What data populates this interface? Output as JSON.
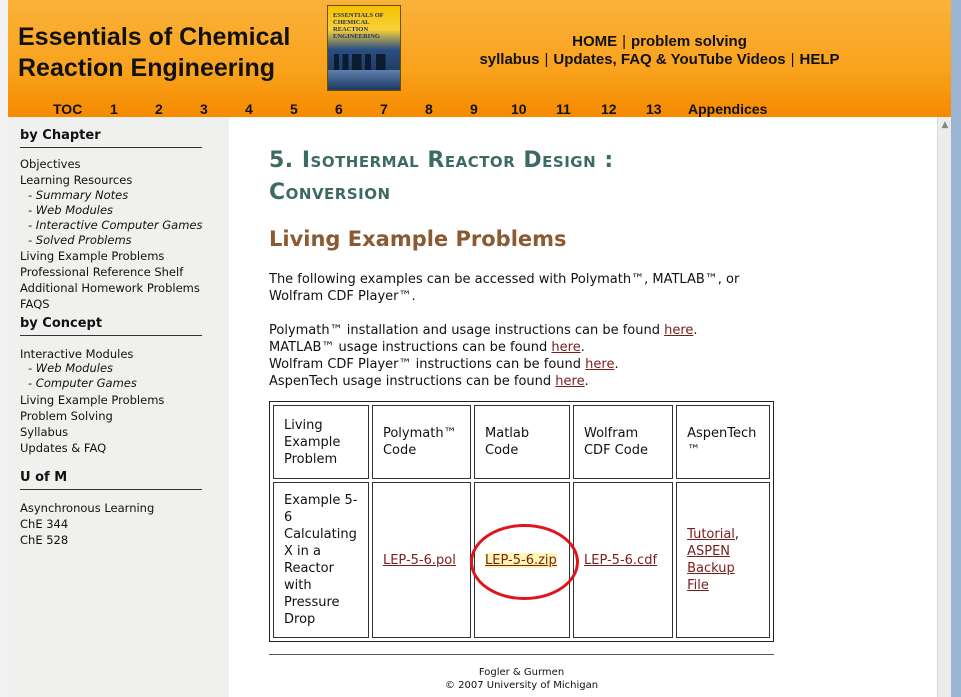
{
  "site": {
    "title": "Essentials of Chemical\nReaction Engineering",
    "book_cover_title": "ESSENTIALS OF CHEMICAL REACTION ENGINEERING"
  },
  "top_nav": {
    "home": "HOME",
    "problem_solving": "problem solving",
    "syllabus": "syllabus",
    "updates": "Updates, FAQ & YouTube Videos",
    "help": "HELP",
    "separator": "|"
  },
  "chapter_nav": [
    "TOC",
    "1",
    "2",
    "3",
    "4",
    "5",
    "6",
    "7",
    "8",
    "9",
    "10",
    "11",
    "12",
    "13",
    "Appendices"
  ],
  "sidebar": {
    "by_chapter": {
      "heading": "by Chapter",
      "items": [
        {
          "label": "Objectives"
        },
        {
          "label": "Learning Resources"
        },
        {
          "label": "- Summary Notes"
        },
        {
          "label": "- Web Modules"
        },
        {
          "label": "- Interactive Computer Games"
        },
        {
          "label": "- Solved Problems"
        },
        {
          "label": "Living Example Problems"
        },
        {
          "label": "Professional Reference Shelf"
        },
        {
          "label": "Additional Homework Problems"
        },
        {
          "label": "FAQS"
        }
      ]
    },
    "by_concept": {
      "heading": "by Concept",
      "items": [
        {
          "label": "Interactive Modules"
        },
        {
          "label": "- Web Modules"
        },
        {
          "label": "- Computer Games"
        },
        {
          "label": "Living Example Problems"
        },
        {
          "label": "Problem Solving"
        },
        {
          "label": "Syllabus"
        },
        {
          "label": "Updates & FAQ"
        }
      ]
    },
    "u_of_m": {
      "heading": "U of M",
      "items": [
        {
          "label": "Asynchronous Learning"
        },
        {
          "label": "ChE 344"
        },
        {
          "label": "ChE 528"
        }
      ]
    }
  },
  "main": {
    "heading": "5. Isothermal Reactor Design : Conversion",
    "section_heading": "Living Example Problems",
    "intro": "The following examples can be accessed with Polymath™, MATLAB™, or Wolfram CDF Player™.",
    "instructions": [
      {
        "text": "Polymath™ installation and usage instructions can be found ",
        "link": "here",
        "end": "."
      },
      {
        "text": "MATLAB™ usage instructions can be found ",
        "link": "here",
        "end": "."
      },
      {
        "text": "Wolfram CDF Player™ instructions can be found ",
        "link": "here",
        "end": "."
      },
      {
        "text": "AspenTech usage instructions can be found ",
        "link": "here",
        "end": "."
      }
    ],
    "table": {
      "headers": [
        "Living Example Problem",
        "Polymath™ Code",
        "Matlab Code",
        "Wolfram CDF Code",
        "AspenTech ™"
      ],
      "row": {
        "problem": "Example 5-6 Calculating X in a Reactor with Pressure Drop",
        "polymath": "LEP-5-6.pol",
        "matlab": "LEP-5-6.zip",
        "wolfram": "LEP-5-6.cdf",
        "aspen_tutorial": "Tutorial",
        "aspen_comma": ",",
        "aspen_backup": "ASPEN Backup File"
      }
    },
    "footer": {
      "line1": "Fogler & Gurmen",
      "line2": "© 2007 University of Michigan"
    }
  },
  "colors": {
    "header_orange": "#f9a21c",
    "heading_teal": "#3e6a64",
    "section_brown": "#8a5a32",
    "link": "#7a1d1d",
    "annotation_red": "#e0151c"
  },
  "icons": {
    "scroll_up": "▲"
  }
}
